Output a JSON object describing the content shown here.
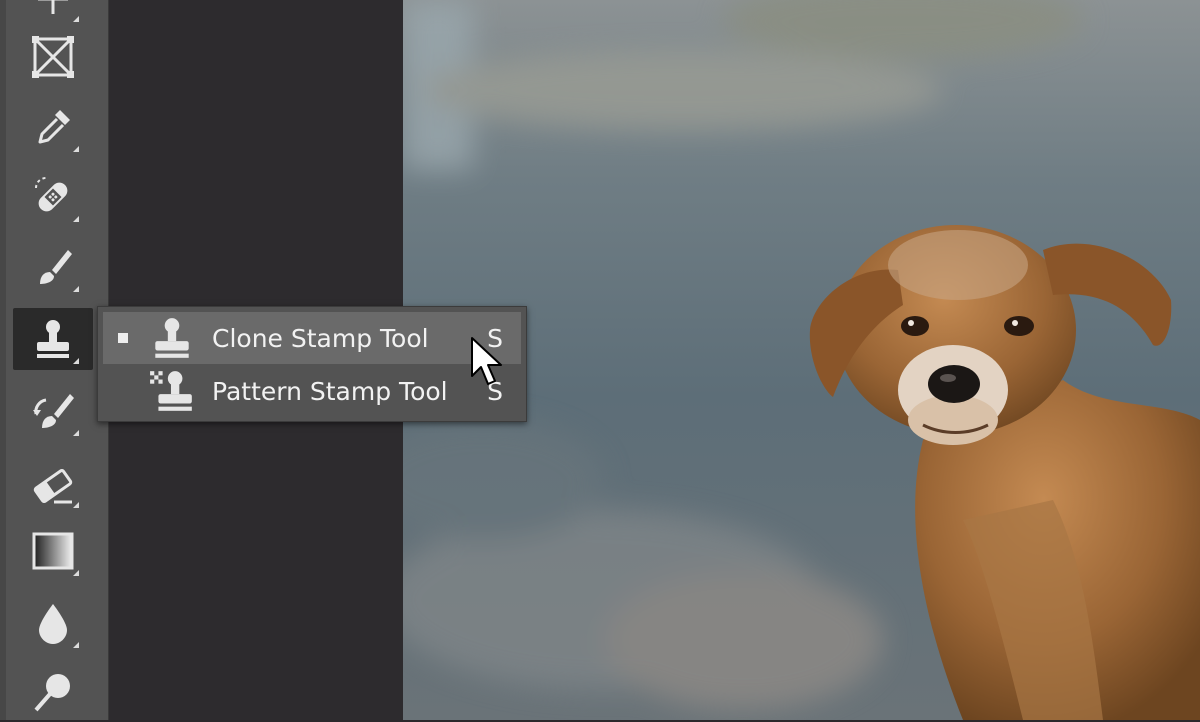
{
  "colors": {
    "toolbar_bg": "#535353",
    "workspace_bg": "#2d2b2e",
    "menu_bg": "#535353",
    "menu_active_bg": "#6a6a6a",
    "text": "#f2f2f2"
  },
  "toolbar": {
    "tools": [
      {
        "name": "move-tool",
        "icon": "move-icon"
      },
      {
        "name": "frame-tool",
        "icon": "frame-icon"
      },
      {
        "name": "eyedropper-tool",
        "icon": "eyedropper-icon"
      },
      {
        "name": "healing-brush-tool",
        "icon": "bandage-icon"
      },
      {
        "name": "brush-tool",
        "icon": "brush-icon"
      },
      {
        "name": "clone-stamp-tool",
        "icon": "stamp-icon",
        "selected": true
      },
      {
        "name": "history-brush-tool",
        "icon": "history-brush-icon"
      },
      {
        "name": "eraser-tool",
        "icon": "eraser-icon"
      },
      {
        "name": "gradient-tool",
        "icon": "gradient-icon"
      },
      {
        "name": "blur-tool",
        "icon": "drop-icon"
      },
      {
        "name": "dodge-tool",
        "icon": "dodge-icon"
      }
    ]
  },
  "flyout": {
    "items": [
      {
        "label": "Clone Stamp Tool",
        "shortcut": "S",
        "icon": "stamp-icon",
        "active": true
      },
      {
        "label": "Pattern Stamp Tool",
        "shortcut": "S",
        "icon": "pattern-stamp-icon",
        "active": false
      }
    ]
  }
}
